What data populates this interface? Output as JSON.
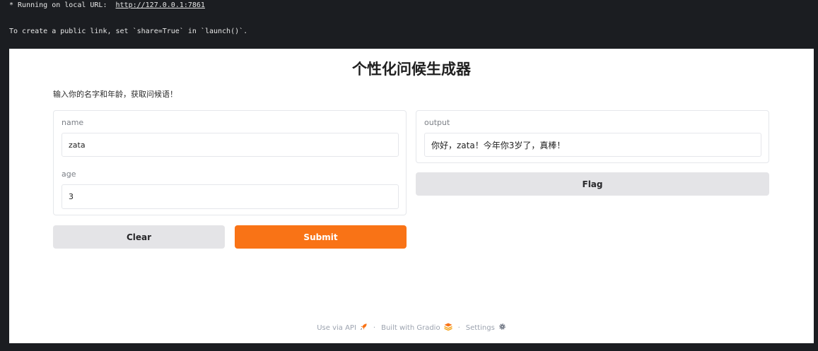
{
  "terminal": {
    "line1_prefix": "* Running on local URL:  ",
    "line1_url": "http://127.0.0.1:7861",
    "line2": "To create a public link, set `share=True` in `launch()`."
  },
  "app": {
    "title": "个性化问候生成器",
    "description": "输入你的名字和年龄，获取问候语！",
    "inputs": {
      "name_label": "name",
      "name_value": "zata",
      "age_label": "age",
      "age_value": "3"
    },
    "output": {
      "label": "output",
      "value": "你好，zata！今年你3岁了，真棒！"
    },
    "buttons": {
      "clear": "Clear",
      "submit": "Submit",
      "flag": "Flag"
    },
    "footer": {
      "api": "Use via API",
      "built": "Built with Gradio",
      "settings": "Settings",
      "separator": "·"
    },
    "colors": {
      "primary": "#f97316",
      "secondary": "#e4e4e7"
    },
    "icons": {
      "api": "rocket-icon",
      "gradio": "gradio-logo-icon",
      "settings": "gear-icon"
    }
  }
}
